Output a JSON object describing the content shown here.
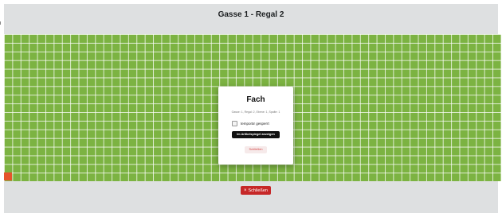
{
  "header": {
    "title": "Gasse 1 - Regal 2"
  },
  "modal": {
    "title": "Fach",
    "location": "Gasse: 1, Regal: 2, Ebene: 1, Spalte: 1",
    "lock_label": "temporär gesperrt",
    "mirror_button": "Im Artikelspiegel anzeigen",
    "close_button": "Schließen"
  },
  "footer": {
    "close_button": "Schließen",
    "close_icon": "×"
  },
  "colors": {
    "grid": "#7cb342",
    "marked_cell": "#e5542b",
    "close_button": "#c62828"
  }
}
